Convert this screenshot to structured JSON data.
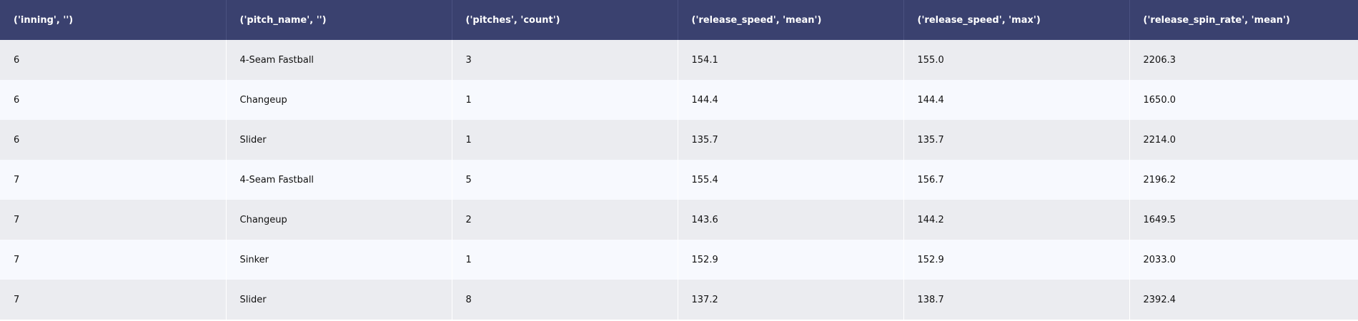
{
  "table": {
    "columns": [
      "('inning', '')",
      "('pitch_name', '')",
      "('pitches', 'count')",
      "('release_speed', 'mean')",
      "('release_speed', 'max')",
      "('release_spin_rate', 'mean')"
    ],
    "rows": [
      [
        "6",
        "4-Seam Fastball",
        "3",
        "154.1",
        "155.0",
        "2206.3"
      ],
      [
        "6",
        "Changeup",
        "1",
        "144.4",
        "144.4",
        "1650.0"
      ],
      [
        "6",
        "Slider",
        "1",
        "135.7",
        "135.7",
        "2214.0"
      ],
      [
        "7",
        "4-Seam Fastball",
        "5",
        "155.4",
        "156.7",
        "2196.2"
      ],
      [
        "7",
        "Changeup",
        "2",
        "143.6",
        "144.2",
        "1649.5"
      ],
      [
        "7",
        "Sinker",
        "1",
        "152.9",
        "152.9",
        "2033.0"
      ],
      [
        "7",
        "Slider",
        "8",
        "137.2",
        "138.7",
        "2392.4"
      ]
    ]
  }
}
